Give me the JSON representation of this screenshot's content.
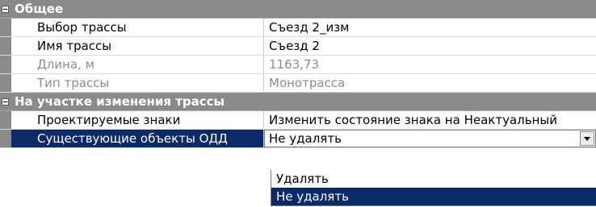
{
  "categories": [
    {
      "title": "Общее",
      "rows": [
        {
          "name": "Выбор трассы",
          "value": "Съезд 2_изм",
          "readonly": false
        },
        {
          "name": "Имя трассы",
          "value": "Съезд 2",
          "readonly": false
        },
        {
          "name": "Длина, м",
          "value": "1163,73",
          "readonly": true
        },
        {
          "name": "Тип трассы",
          "value": "Монотрасса",
          "readonly": true
        }
      ]
    },
    {
      "title": "На участке изменения трассы",
      "rows": [
        {
          "name": "Проектируемые знаки",
          "value": "Изменить состояние знака на Неактуальный",
          "readonly": false
        },
        {
          "name": "Существующие объекты ОДД",
          "value": "Не удалять",
          "readonly": false
        }
      ]
    }
  ],
  "dropdown": {
    "options": [
      "Удалять",
      "Не удалять"
    ],
    "selected": "Не удалять"
  },
  "icons": {
    "collapse": "minus-box-icon",
    "combo_arrow": "chevron-down-icon"
  },
  "colors": {
    "category_bg": "#8a8a8a",
    "selection_bg": "#0b2a69",
    "readonly_text": "#8c8c8c"
  }
}
